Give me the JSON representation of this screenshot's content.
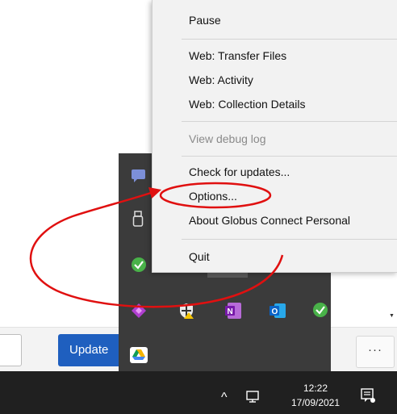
{
  "app": {
    "update_label": "Update",
    "more_label": "···"
  },
  "menu": {
    "pause": "Pause",
    "transfer_files": "Web: Transfer Files",
    "activity": "Web: Activity",
    "collection_details": "Web: Collection Details",
    "debug_log": "View debug log",
    "check_updates": "Check for updates...",
    "options": "Options...",
    "about": "About Globus Connect Personal",
    "quit": "Quit"
  },
  "tray_icons": [
    "chat-icon",
    "usb-drive-icon",
    "globus-check-icon",
    "diamond-app-icon",
    "security-shield-icon",
    "onenote-icon",
    "outlook-icon",
    "green-check-icon",
    "google-drive-icon"
  ],
  "taskbar": {
    "time": "12:22",
    "date": "17/09/2021",
    "caret": "^"
  },
  "colors": {
    "accent": "#1f5fbf",
    "annotation": "#e01010",
    "taskbar": "#202020",
    "flyout": "#3b3b3b"
  }
}
